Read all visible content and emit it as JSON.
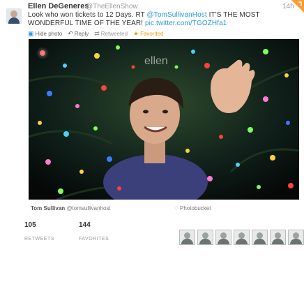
{
  "tweet": {
    "name": "Ellen DeGeneres",
    "handle": "@TheEllenShow",
    "time": "14h",
    "text_start": "Look who won tickets to 12 Days. RT ",
    "mention": "@TomSullivanHost",
    "text_mid": " IT'S THE MOST WONDERFUL TIME OF THE YEAR! ",
    "link": "pic.twitter.com/TGOZHfa1",
    "actions": {
      "hide_photo": "Hide photo",
      "reply": "Reply",
      "retweeted": "Retweeted",
      "favorited": "Favorited"
    },
    "photo_credit": {
      "name": "Tom Sullivan",
      "handle": "@tomsullivanhost",
      "via": "Photobucket"
    },
    "stats": {
      "retweets_count": "105",
      "retweets_label": "RETWEETS",
      "favorites_count": "144",
      "favorites_label": "FAVORITES"
    },
    "watermark": "ellen"
  },
  "colors": {
    "link": "#2a9adb",
    "favorited": "#e8a10c",
    "corner": "#ff9a2e"
  }
}
